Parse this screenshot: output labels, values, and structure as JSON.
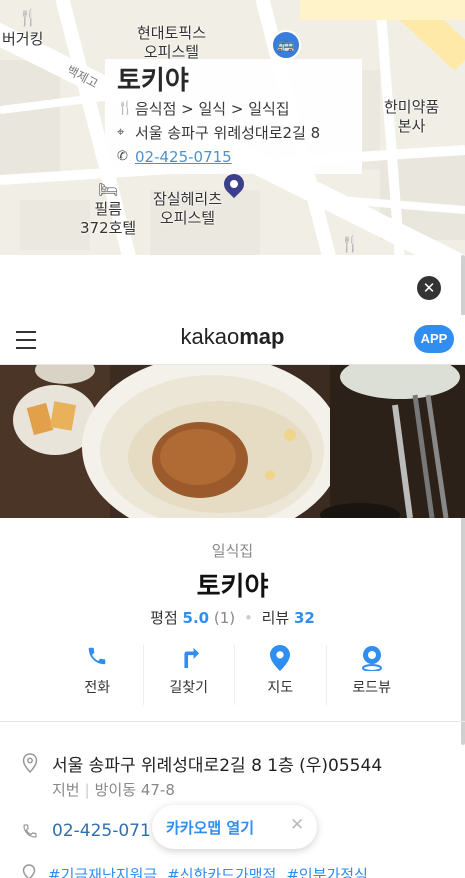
{
  "map": {
    "labels": {
      "burger_king": "버거킹",
      "hyundai_topics": "현대토픽스\n오피스텔",
      "road_name": "백제고",
      "pharmacy": "한미약품\n본사",
      "film_hotel": "필름\n372호텔",
      "jamsil_heritage": "잠실헤리츠\n오피스텔"
    },
    "info_card": {
      "title": "토키야",
      "category_path": "음식점 > 일식 > 일식집",
      "address": "서울 송파구 위례성대로2길 8",
      "phone": "02-425-0715"
    }
  },
  "close_label": "✕",
  "header": {
    "logo_light": "kakao",
    "logo_bold": "map",
    "app_button": "APP"
  },
  "place": {
    "category": "일식집",
    "name": "토키야",
    "rating_label": "평점",
    "rating_value": "5.0",
    "rating_count": "(1)",
    "review_label": "리뷰",
    "review_count": "32",
    "actions": [
      {
        "label": "전화",
        "icon": "phone-icon"
      },
      {
        "label": "길찾기",
        "icon": "directions-icon"
      },
      {
        "label": "지도",
        "icon": "map-pin-icon"
      },
      {
        "label": "로드뷰",
        "icon": "roadview-icon"
      }
    ],
    "address_main": "서울 송파구 위례성대로2길 8 1층 (우)05544",
    "address_lot_label": "지번",
    "address_lot": "방이동 47-8",
    "phone": "02-425-071",
    "open_app_label": "카카오맵 열기",
    "open_app_close": "✕",
    "tags": [
      "#기금재난지원금",
      "#신한카드가맹점",
      "#인분가정식"
    ]
  },
  "colors": {
    "accent": "#2f8ef0",
    "map_background": "#f2efe6",
    "bus_stop": "#3a7ddb",
    "pin": "#3b3f8c"
  }
}
